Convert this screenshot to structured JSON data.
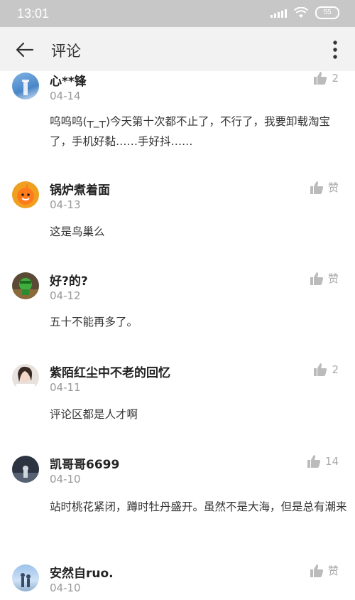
{
  "status_bar": {
    "time": "13:01",
    "battery": "55"
  },
  "app_bar": {
    "title": "评论"
  },
  "comments": [
    {
      "name": "心**锋",
      "date": "04-14",
      "content": "呜呜呜(┬_┬)今天第十次都不止了，不行了，我要卸载淘宝了，手机好黏……手好抖……",
      "likes": "2"
    },
    {
      "name": "锅炉煮着面",
      "date": "04-13",
      "content": "这是鸟巢么",
      "likes": "赞"
    },
    {
      "name": "好?的?",
      "date": "04-12",
      "content": "五十不能再多了。",
      "likes": "赞"
    },
    {
      "name": "紫陌红尘中不老的回忆",
      "date": "04-11",
      "content": "评论区都是人才啊",
      "likes": "2"
    },
    {
      "name": "凯哥哥6699",
      "date": "04-10",
      "content": "站时桃花紧闭，蹲时牡丹盛开。虽然不是大海，但是总有潮来",
      "likes": "14"
    },
    {
      "name": "安然自ruo.",
      "date": "04-10",
      "content": "",
      "likes": "赞"
    }
  ],
  "colors": {
    "status_bar": "#c7c7c7",
    "app_bar": "#f2f2f2",
    "muted": "#999999"
  }
}
